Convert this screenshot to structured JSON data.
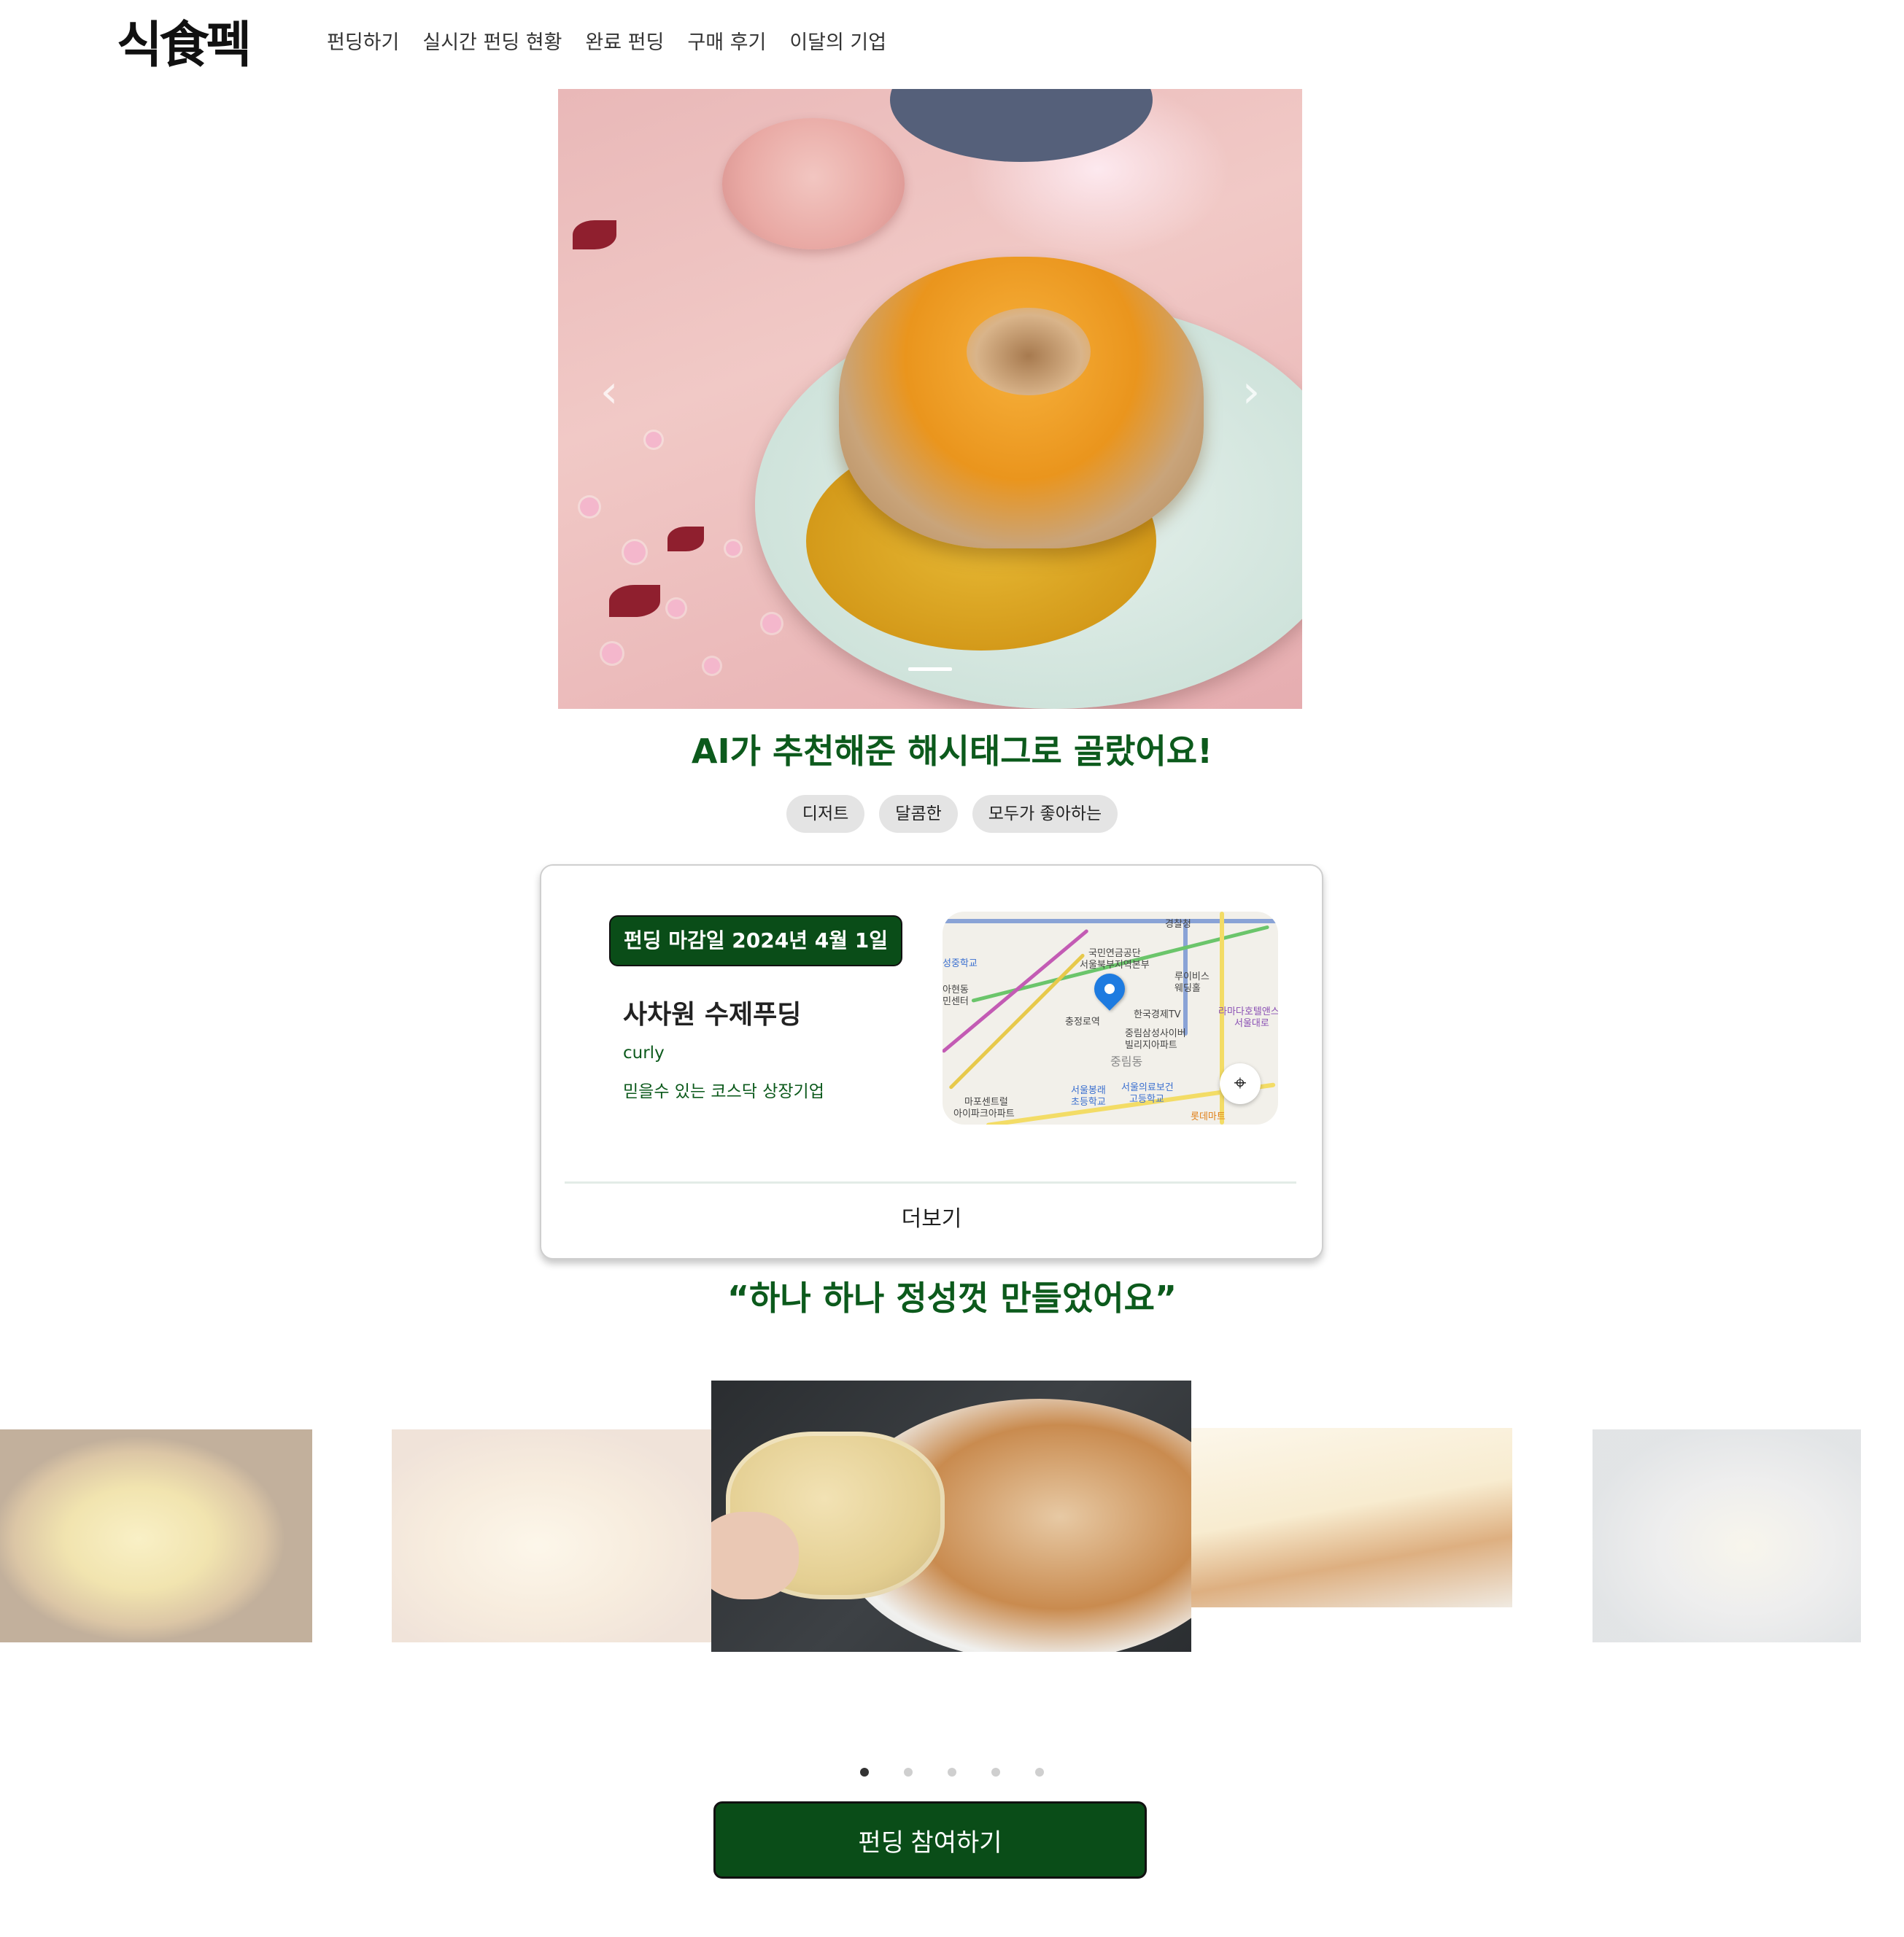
{
  "header": {
    "logo": "식食펙",
    "nav": [
      "펀딩하기",
      "실시간 펀딩 현황",
      "완료 펀딩",
      "구매 후기",
      "이달의 기업"
    ]
  },
  "hero": {
    "prev_icon": "chevron-left-icon",
    "next_icon": "chevron-right-icon",
    "slide_indicator": "active"
  },
  "ai_section": {
    "title": "AI가 추천해준 해시태그로 골랐어요!",
    "tags": [
      "디저트",
      "달콤한",
      "모두가 좋아하는"
    ]
  },
  "funding_card": {
    "deadline": "펀딩 마감일 2024년 4월 1일",
    "product_name": "사차원 수제푸딩",
    "company": "curly",
    "company_desc": "믿을수 있는 코스닥 상장기업",
    "more_label": "더보기",
    "map": {
      "labels": [
        "경찰청",
        "국민연금공단",
        "서울북부지역본부",
        "루이비스",
        "웨딩홀",
        "성중학교",
        "아현동",
        "민센터",
        "충정로역",
        "한국경제TV",
        "라마다호텔앤스",
        "서울대로",
        "중림삼성사이버",
        "빌리지아파트",
        "중림동",
        "마포센트럴",
        "아이파크아파트",
        "서울봉래",
        "초등학교",
        "서울의료보건",
        "고등학교",
        "롯데마트"
      ],
      "locate_icon": "crosshair-icon"
    }
  },
  "quote": "“하나 하나 정성껏 만들었어요”",
  "gallery": {
    "slides": [
      "whisking-custard",
      "mixing-egg",
      "pouring-custard-over-bread",
      "slicing-pudding",
      "straining-custard"
    ],
    "active_index": 2
  },
  "pagination": {
    "count": 5,
    "active": 0
  },
  "cta": {
    "label": "펀딩 참여하기"
  },
  "colors": {
    "brand_green": "#0a4d18",
    "text_green": "#0c5a1c",
    "tag_bg": "#e4e4e4"
  }
}
